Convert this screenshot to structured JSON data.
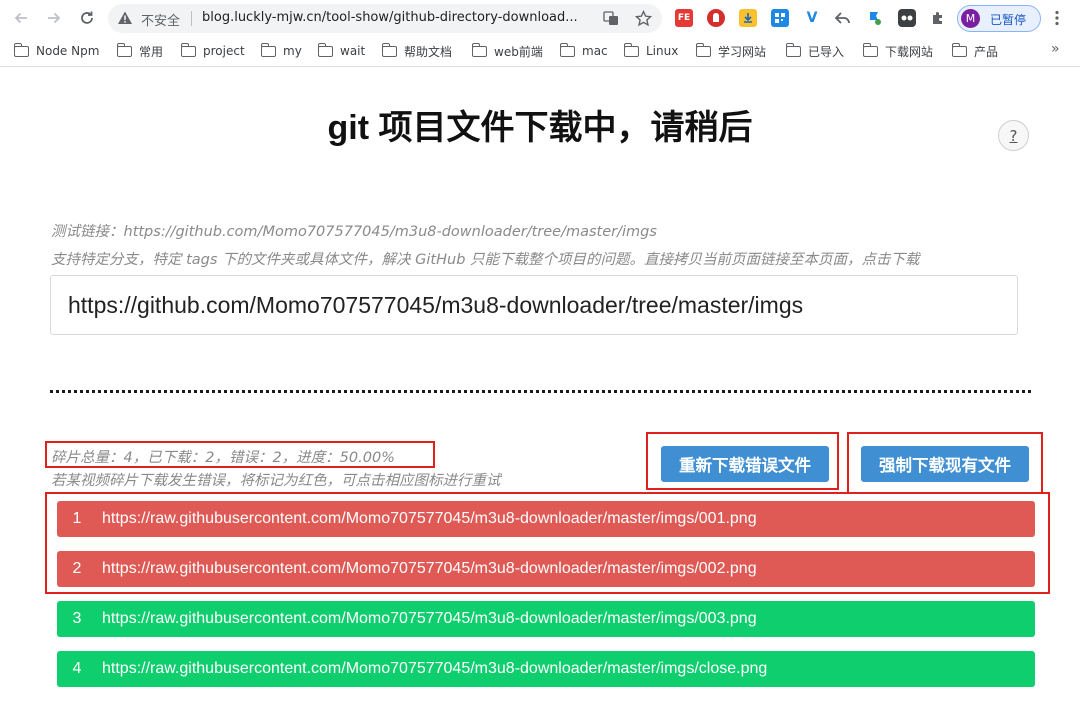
{
  "browser": {
    "insecure_label": "不安全",
    "url": "blog.luckly-mjw.cn/tool-show/github-directory-download...",
    "profile_initial": "M",
    "profile_label": "已暂停",
    "extensions": [
      {
        "name": "fe-helper-icon",
        "text": "FE",
        "color": "#e53935"
      },
      {
        "name": "ublock-icon",
        "text": "",
        "color": "#d32f2f"
      },
      {
        "name": "download-ext-icon",
        "text": "",
        "color": "#fbc02d"
      },
      {
        "name": "qr-code-icon",
        "text": "",
        "color": "#1e88e5"
      },
      {
        "name": "vue-devtools-icon",
        "text": "V",
        "color": "#1e88e5"
      },
      {
        "name": "back-arrow-ext-icon",
        "text": "",
        "color": "#5f6368"
      },
      {
        "name": "extension-flag-icon",
        "text": "",
        "color": "#43a047"
      },
      {
        "name": "tampermonkey-icon",
        "text": "",
        "color": "#3c4043"
      },
      {
        "name": "puzzle-icon",
        "text": "",
        "color": "#5f6368"
      }
    ]
  },
  "bookmarks": [
    "Node Npm",
    "常用",
    "project",
    "my",
    "wait",
    "帮助文档",
    "web前端",
    "mac",
    "Linux",
    "学习网站",
    "已导入",
    "下载网站",
    "产品"
  ],
  "page": {
    "title": "git 项目文件下载中，请稍后",
    "help_label": "?",
    "test_link_hint": "测试链接：https://github.com/Momo707577045/m3u8-downloader/tree/master/imgs",
    "support_hint": "支持特定分支，特定 tags 下的文件夹或具体文件，解决 GitHub 只能下载整个项目的问题。直接拷贝当前页面链接至本页面，点击下载",
    "input_value": "https://github.com/Momo707577045/m3u8-downloader/tree/master/imgs",
    "stats": "碎片总量：4，已下载：2，错误：2，进度：50.00%",
    "error_hint": "若某视频碎片下载发生错误，将标记为红色，可点击相应图标进行重试",
    "retry_button": "重新下载错误文件",
    "force_button": "强制下载现有文件"
  },
  "files": [
    {
      "index": "1",
      "url": "https://raw.githubusercontent.com/Momo707577045/m3u8-downloader/master/imgs/001.png",
      "status": "error"
    },
    {
      "index": "2",
      "url": "https://raw.githubusercontent.com/Momo707577045/m3u8-downloader/master/imgs/002.png",
      "status": "error"
    },
    {
      "index": "3",
      "url": "https://raw.githubusercontent.com/Momo707577045/m3u8-downloader/master/imgs/003.png",
      "status": "ok"
    },
    {
      "index": "4",
      "url": "https://raw.githubusercontent.com/Momo707577045/m3u8-downloader/master/imgs/close.png",
      "status": "ok"
    }
  ],
  "colors": {
    "error": "#e05a55",
    "success": "#0fce6d",
    "button": "#3f8fd2",
    "annotation": "#e0201c"
  }
}
